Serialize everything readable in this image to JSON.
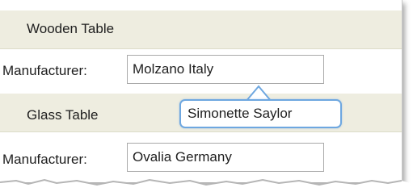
{
  "items": [
    {
      "title": "Wooden Table",
      "manufacturer_label": "Manufacturer:",
      "manufacturer_value": "Molzano Italy"
    },
    {
      "title": "Glass Table",
      "manufacturer_label": "Manufacturer:",
      "manufacturer_value": "Ovalia Germany"
    }
  ],
  "tooltip": {
    "text": "Simonette Saylor"
  },
  "colors": {
    "header_bg": "#eeede0",
    "tooltip_border": "#6ea7e0",
    "field_border": "#a9a9a9"
  }
}
